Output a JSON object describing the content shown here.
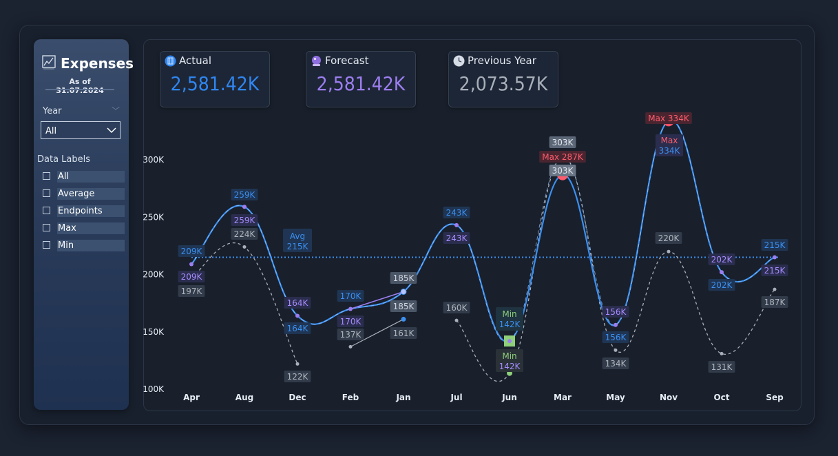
{
  "sidebar": {
    "title": "Expenses",
    "as_of": "As of 31.07.2024",
    "year_label": "Year",
    "year_value": "All",
    "data_labels_title": "Data Labels",
    "checkboxes": [
      {
        "label": "All",
        "checked": false
      },
      {
        "label": "Average",
        "checked": false
      },
      {
        "label": "Endpoints",
        "checked": false
      },
      {
        "label": "Max",
        "checked": false
      },
      {
        "label": "Min",
        "checked": false
      }
    ]
  },
  "cards": {
    "actual": {
      "title": "Actual",
      "value": "2,581.42K",
      "color": "#2f86f0"
    },
    "forecast": {
      "title": "Forecast",
      "value": "2,581.42K",
      "color": "#9c7ef0"
    },
    "previous": {
      "title": "Previous Year",
      "value": "2,073.57K",
      "color": "#a8afb9"
    }
  },
  "chart_data": {
    "type": "line",
    "categories": [
      "Apr",
      "Aug",
      "Dec",
      "Feb",
      "Jan",
      "Jul",
      "Jun",
      "Mar",
      "May",
      "Nov",
      "Oct",
      "Sep"
    ],
    "yticks": [
      "300K",
      "250K",
      "200K",
      "150K",
      "100K"
    ],
    "ylim": [
      100,
      300
    ],
    "grid": false,
    "average": {
      "value": 215,
      "label_top": "Avg",
      "label_bottom": "215K"
    },
    "series": [
      {
        "key": "actual",
        "color": "#3b8ff0",
        "values": [
          209,
          259,
          164,
          170,
          185,
          243,
          142,
          287,
          156,
          334,
          202,
          215
        ],
        "labels": [
          "209K",
          "259K",
          "164K",
          "170K",
          "185K",
          "243K",
          "142K",
          "287K",
          "156K",
          "334K",
          "202K",
          "215K"
        ]
      },
      {
        "key": "forecast",
        "color": "#9c7ef0",
        "values": [
          209,
          259,
          164,
          170,
          185,
          243,
          142,
          303,
          156,
          334,
          202,
          215
        ],
        "labels": [
          "209K",
          "259K",
          "164K",
          "170K",
          "185K",
          "243K",
          "142K",
          "303K",
          "156K",
          "334K",
          "202K",
          "215K"
        ]
      },
      {
        "key": "previous",
        "color": "#9aa3af",
        "values": [
          197,
          224,
          122,
          137,
          161,
          160,
          114,
          303,
          134,
          220,
          131,
          187
        ],
        "labels": [
          "197K",
          "224K",
          "122K",
          "137K",
          "161K",
          "160K",
          "",
          "303K",
          "134K",
          "220K",
          "131K",
          "187K"
        ]
      }
    ],
    "annotations": {
      "max_prefix": "Max",
      "max_mar_label": "Max 287K",
      "max_nov_label": "Max 334K",
      "max_nov_second": [
        "Max",
        "334K"
      ],
      "min_label": [
        "Min",
        "142K"
      ],
      "mar_303_top": "303K",
      "mar_303_bottom": "303K",
      "jan_185_top": "185K",
      "jan_185_bottom": "185K"
    }
  }
}
